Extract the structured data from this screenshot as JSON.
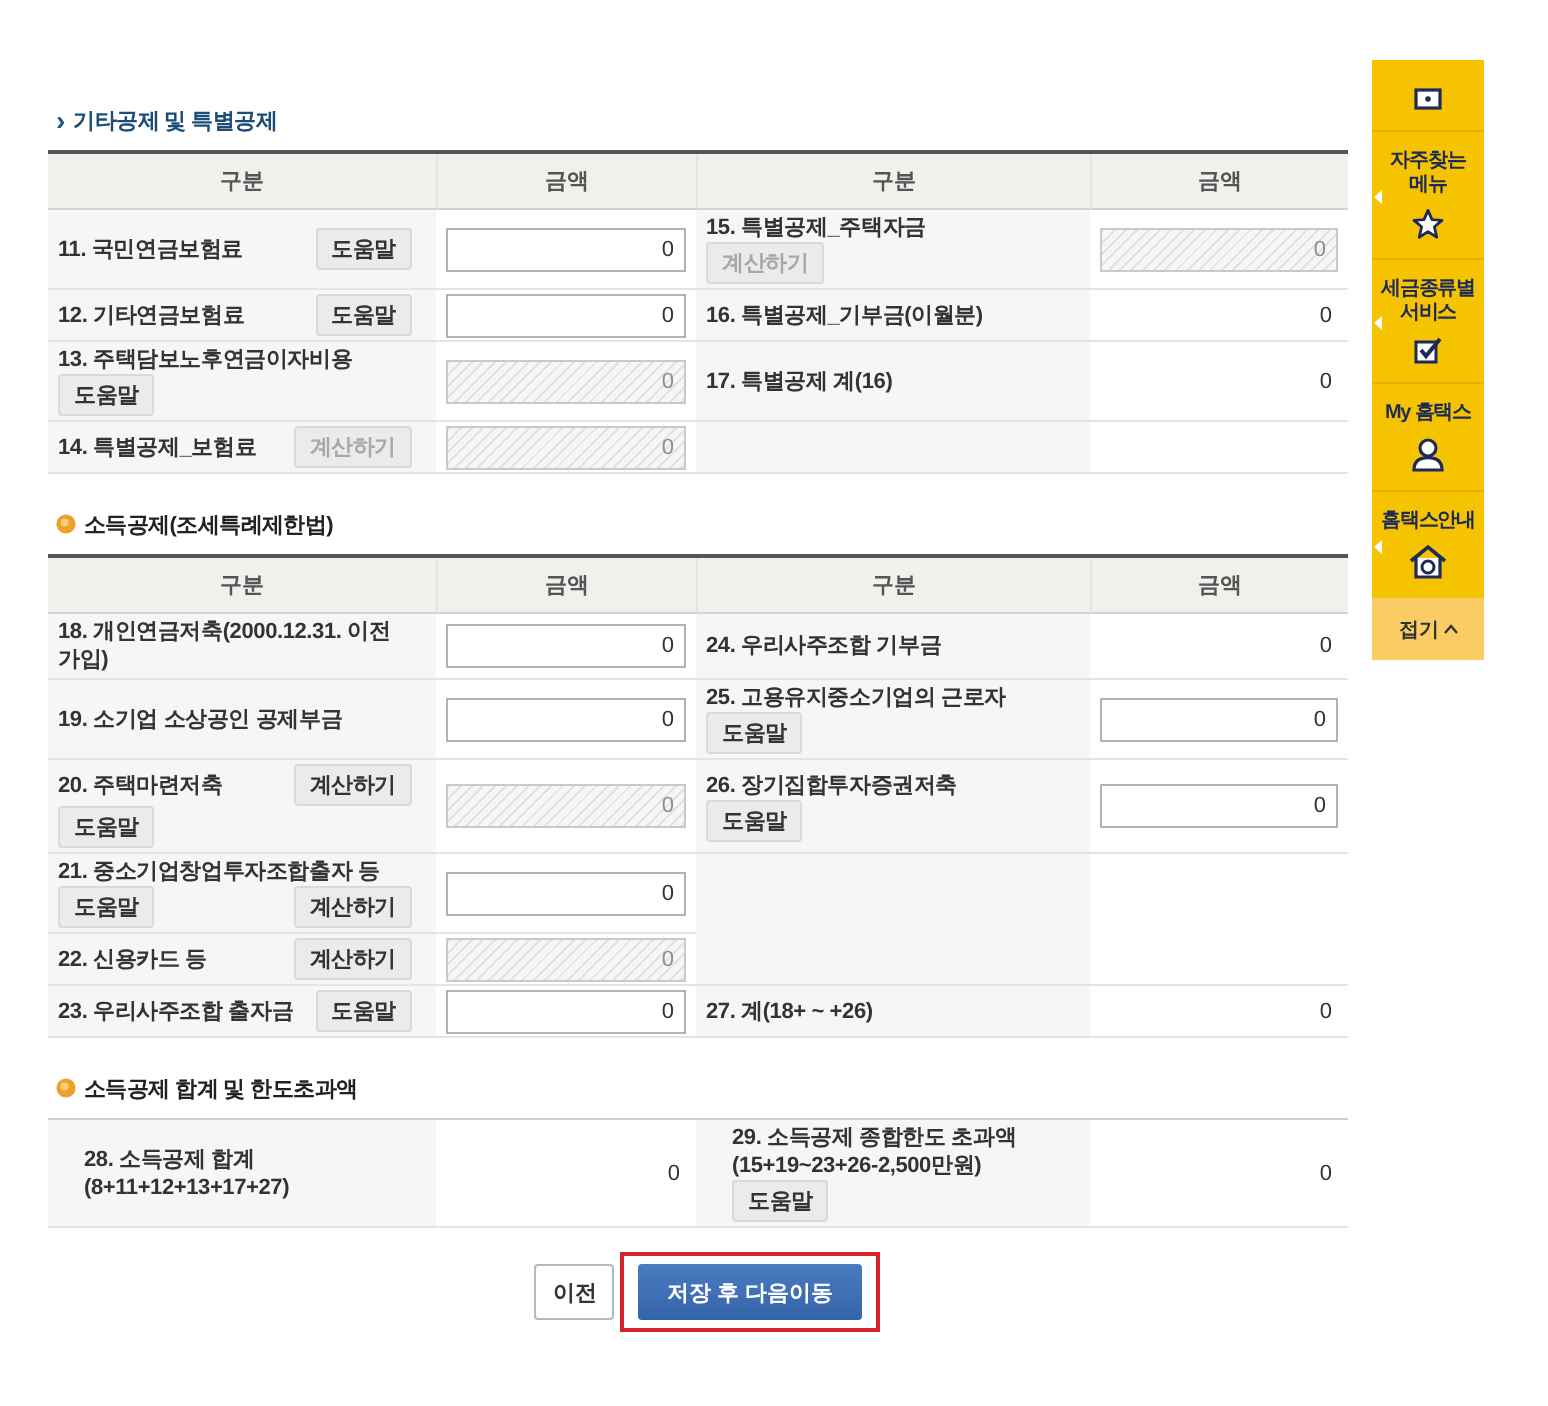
{
  "sections": [
    {
      "kind": "table",
      "marker": "›",
      "title": "기타공제 및 특별공제",
      "columns": [
        "구분",
        "금액",
        "구분",
        "금액"
      ],
      "rows": [
        {
          "left": {
            "label": "11. 국민연금보험료",
            "buttons": [
              {
                "label": "도움말",
                "disabled": false
              }
            ],
            "amount": {
              "kind": "field",
              "value": "0",
              "disabled": false
            }
          },
          "right": {
            "label": "15. 특별공제_주택자금",
            "buttons": [
              {
                "label": "계산하기",
                "disabled": true
              }
            ],
            "amount": {
              "kind": "field",
              "value": "0",
              "disabled": true
            }
          }
        },
        {
          "left": {
            "label": "12. 기타연금보험료",
            "buttons": [
              {
                "label": "도움말",
                "disabled": false
              }
            ],
            "amount": {
              "kind": "field",
              "value": "0",
              "disabled": false
            }
          },
          "right": {
            "label": "16. 특별공제_기부금(이월분)",
            "amount": {
              "kind": "text",
              "value": "0"
            }
          }
        },
        {
          "left": {
            "label": "13. 주택담보노후연금이자비용",
            "buttons": [
              {
                "label": "도움말",
                "disabled": false
              }
            ],
            "amount": {
              "kind": "field",
              "value": "0",
              "disabled": true
            }
          },
          "right": {
            "label": "17. 특별공제 계(16)",
            "amount": {
              "kind": "text",
              "value": "0"
            }
          }
        },
        {
          "left": {
            "label": "14. 특별공제_보험료",
            "buttons": [
              {
                "label": "계산하기",
                "disabled": true
              }
            ],
            "amount": {
              "kind": "field",
              "value": "0",
              "disabled": true
            }
          }
        }
      ]
    },
    {
      "kind": "table",
      "title": "소득공제(조세특례제한법)",
      "columns": [
        "구분",
        "금액",
        "구분",
        "금액"
      ],
      "rows": [
        {
          "left": {
            "label": "18. 개인연금저축(2000.12.31. 이전 가입)",
            "amount": {
              "kind": "field",
              "value": "0",
              "disabled": false
            }
          },
          "right": {
            "label": "24. 우리사주조합 기부금",
            "amount": {
              "kind": "text",
              "value": "0"
            }
          }
        },
        {
          "left": {
            "label": "19. 소기업 소상공인 공제부금",
            "amount": {
              "kind": "field",
              "value": "0",
              "disabled": false
            }
          },
          "right": {
            "label": "25. 고용유지중소기업의 근로자",
            "buttons": [
              {
                "label": "도움말",
                "disabled": false
              }
            ],
            "amount": {
              "kind": "field",
              "value": "0",
              "disabled": false
            }
          }
        },
        {
          "left": {
            "label": "20. 주택마련저축",
            "buttons": [
              {
                "label": "계산하기",
                "disabled": false
              },
              {
                "label": "도움말",
                "disabled": false
              }
            ],
            "amount": {
              "kind": "field",
              "value": "0",
              "disabled": true
            }
          },
          "right": {
            "label": "26. 장기집합투자증권저축",
            "buttons": [
              {
                "label": "도움말",
                "disabled": false
              }
            ],
            "amount": {
              "kind": "field",
              "value": "0",
              "disabled": false
            }
          }
        },
        {
          "left": {
            "label": "21. 중소기업창업투자조합출자 등",
            "buttons": [
              {
                "label": "도움말",
                "disabled": false
              },
              {
                "label": "계산하기",
                "disabled": false
              }
            ],
            "amount": {
              "kind": "field",
              "value": "0",
              "disabled": false
            }
          }
        },
        {
          "left": {
            "label": "22. 신용카드 등",
            "buttons": [
              {
                "label": "계산하기",
                "disabled": false
              }
            ],
            "amount": {
              "kind": "field",
              "value": "0",
              "disabled": true
            }
          }
        },
        {
          "left": {
            "label": "23. 우리사주조합 출자금",
            "buttons": [
              {
                "label": "도움말",
                "disabled": false
              }
            ],
            "amount": {
              "kind": "field",
              "value": "0",
              "disabled": false
            }
          },
          "right": {
            "label": "27. 계(18+ ~ +26)",
            "amount": {
              "kind": "text",
              "value": "0"
            }
          }
        }
      ]
    },
    {
      "kind": "summary",
      "title": "소득공제 합계 및 한도초과액",
      "rows": [
        {
          "left": {
            "label": "28. 소득공제 합계(8+11+12+13+17+27)",
            "amount": {
              "kind": "text",
              "value": "0"
            }
          },
          "right": {
            "label": "29. 소득공제 종합한도 초과액(15+19~23+26-2,500만원)",
            "buttons": [
              {
                "label": "도움말",
                "disabled": false
              }
            ],
            "amount": {
              "kind": "text",
              "value": "0"
            }
          }
        }
      ]
    }
  ],
  "buttons": [
    {
      "label": "이전",
      "kind": "secondary",
      "highlighted": false
    },
    {
      "label": "저장 후 다음이동",
      "kind": "primary",
      "highlighted": true
    }
  ],
  "sidebar": {
    "items": [
      {
        "label": "자주찾는 메뉴",
        "flyout": true
      },
      {
        "label": "세금종류별 서비스",
        "flyout": true
      },
      {
        "label": "My 홈택스",
        "flyout": false
      },
      {
        "label": "홈택스안내",
        "flyout": true
      }
    ],
    "collapse": "접기"
  }
}
